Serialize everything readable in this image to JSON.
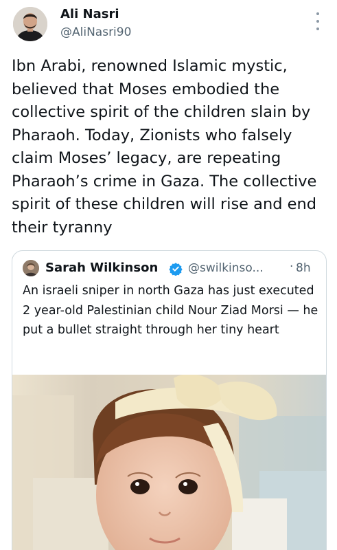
{
  "tweet": {
    "author_name": "Ali Nasri",
    "author_handle": "@AliNasri90",
    "text": "Ibn Arabi, renowned Islamic mystic, believed that Moses embodied the collective spirit of the children slain by Pharaoh. Today, Zionists who falsely claim Moses’ legacy, are repeating Pharaoh’s crime in Gaza. The collective spirit of these children will rise and end their tyranny",
    "more_icon": "more-vertical-icon"
  },
  "quoted_tweet": {
    "author_name": "Sarah Wilkinson",
    "verified_icon": "verified-badge-icon",
    "author_handle": "@swilkinso...",
    "separator": "·",
    "time": "8h",
    "text": "An israeli sniper in north Gaza has just executed 2 year-old Palestinian child Nour Ziad Morsi — he put a bullet straight through her tiny heart",
    "media": "photo"
  },
  "colors": {
    "text_primary": "#0f1419",
    "text_secondary": "#536471",
    "verified": "#1d9bf0",
    "border": "#cfd9de"
  }
}
